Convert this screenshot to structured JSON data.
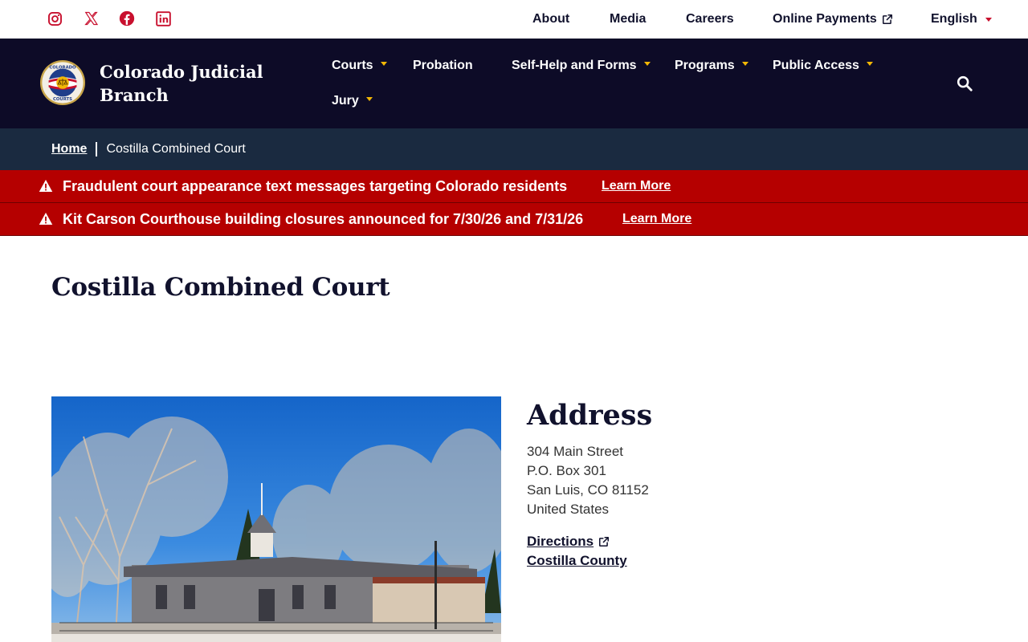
{
  "utility": {
    "social": [
      {
        "icon": "instagram-icon"
      },
      {
        "icon": "x-icon"
      },
      {
        "icon": "facebook-icon"
      },
      {
        "icon": "linkedin-icon"
      }
    ],
    "links": {
      "about": "About",
      "media": "Media",
      "careers": "Careers",
      "payments": "Online Payments",
      "language": "English"
    }
  },
  "header": {
    "site_name": "Colorado Judicial Branch",
    "seal_text_top": "COLORADO",
    "seal_text_bottom": "COURTS",
    "nav": {
      "courts": "Courts",
      "probation": "Probation",
      "self_help": "Self-Help and Forms",
      "programs": "Programs",
      "public_access": "Public Access",
      "jury": "Jury"
    }
  },
  "breadcrumb": {
    "home": "Home",
    "current": "Costilla Combined Court"
  },
  "alerts": [
    {
      "message": "Fraudulent court appearance text messages targeting Colorado residents",
      "link": "Learn More"
    },
    {
      "message": "Kit Carson Courthouse building closures announced for 7/30/26 and 7/31/26",
      "link": "Learn More"
    }
  ],
  "page": {
    "title": "Costilla Combined Court"
  },
  "address": {
    "heading": "Address",
    "lines": [
      "304 Main Street",
      "P.O. Box 301",
      "San Luis, CO 81152",
      "United States"
    ],
    "directions": "Directions",
    "county": "Costilla County"
  },
  "colors": {
    "header_bg": "#0d0b27",
    "breadcrumb_bg": "#1a2a40",
    "alert_bg": "#b50000",
    "social_red": "#c8102e",
    "nav_caret": "#f2b705"
  }
}
